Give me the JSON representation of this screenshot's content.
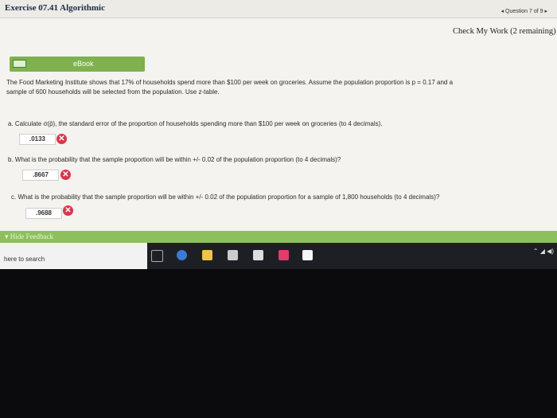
{
  "header": {
    "exercise_title": "Exercise 07.41 Algorithmic",
    "question_nav": "◂ Question 7 of 9 ▸",
    "check_work": "Check My Work (2 remaining)"
  },
  "ebook": {
    "label": "eBook"
  },
  "problem": {
    "intro_line1": "The Food Marketing Institute shows that 17% of households spend more than $100 per week on groceries. Assume the population proportion is p = 0.17 and a",
    "intro_line2": "sample of 600 households will be selected from the population. Use z-table."
  },
  "questions": [
    {
      "text": "a. Calculate σ(p̄), the standard error of the proportion of households spending more than $100 per week on groceries (to 4 decimals).",
      "answer": ".0133"
    },
    {
      "text": "b. What is the probability that the sample proportion will be within +/- 0.02 of the population proportion (to 4 decimals)?",
      "answer": ".8667"
    },
    {
      "text": "c. What is the probability that the sample proportion will be within +/- 0.02 of the population proportion for a sample of 1,800 households (to 4 decimals)?",
      "answer": ".9688"
    }
  ],
  "feedback": {
    "label": "▾ Hide Feedback"
  },
  "taskbar": {
    "search_placeholder": "here to search",
    "tray": "⌃ ◢ ◀)"
  },
  "colors": {
    "green": "#7fb14f",
    "error": "#d8364b"
  }
}
